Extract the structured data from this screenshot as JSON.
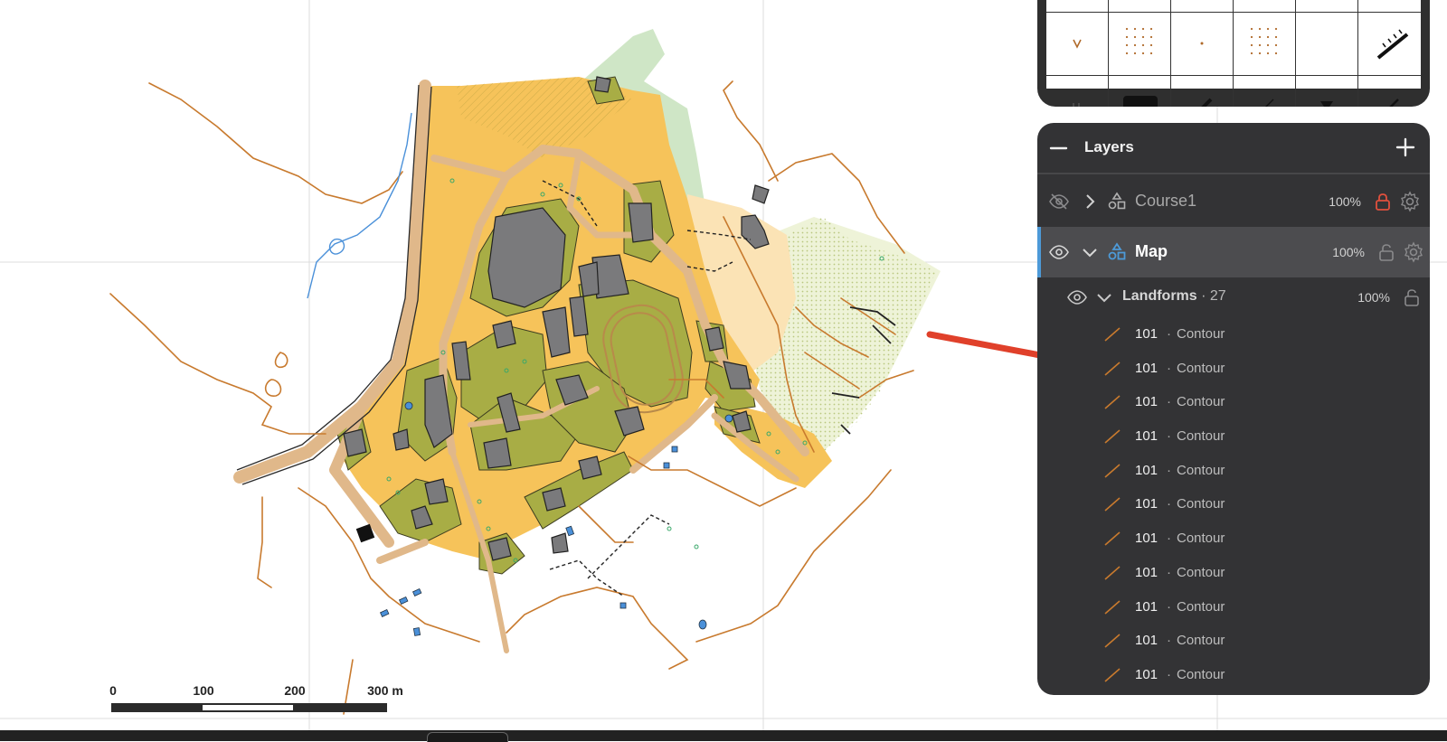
{
  "scale": {
    "labels": [
      "0",
      "100",
      "200",
      "300 m"
    ]
  },
  "layers_panel": {
    "title": "Layers",
    "layers": [
      {
        "name": "Course1",
        "opacity": "100%",
        "visible": false,
        "expanded": false,
        "locked": true
      },
      {
        "name": "Map",
        "opacity": "100%",
        "visible": true,
        "expanded": true,
        "locked": false,
        "selected": true
      }
    ],
    "group": {
      "name": "Landforms",
      "count": "27",
      "opacity": "100%"
    },
    "items": [
      {
        "code": "101",
        "name": "Contour"
      },
      {
        "code": "101",
        "name": "Contour"
      },
      {
        "code": "101",
        "name": "Contour"
      },
      {
        "code": "101",
        "name": "Contour"
      },
      {
        "code": "101",
        "name": "Contour"
      },
      {
        "code": "101",
        "name": "Contour"
      },
      {
        "code": "101",
        "name": "Contour"
      },
      {
        "code": "101",
        "name": "Contour"
      },
      {
        "code": "101",
        "name": "Contour"
      },
      {
        "code": "101",
        "name": "Contour"
      },
      {
        "code": "101",
        "name": "Contour"
      }
    ],
    "separator": "·"
  },
  "colors": {
    "contour": "#c87a2e",
    "lock_active": "#e0503d",
    "accent": "#4d9ad8",
    "annotation_arrow": "#e0402a"
  }
}
